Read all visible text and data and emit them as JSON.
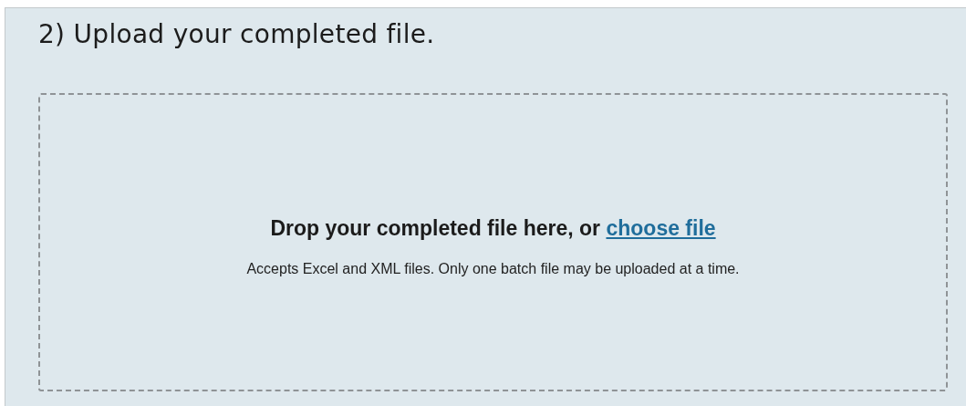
{
  "section": {
    "heading": "2) Upload your completed file."
  },
  "dropzone": {
    "prompt": "Drop your completed file here, or",
    "link": "choose file",
    "note": "Accepts Excel and XML files. Only one batch file may be uploaded at a time."
  }
}
